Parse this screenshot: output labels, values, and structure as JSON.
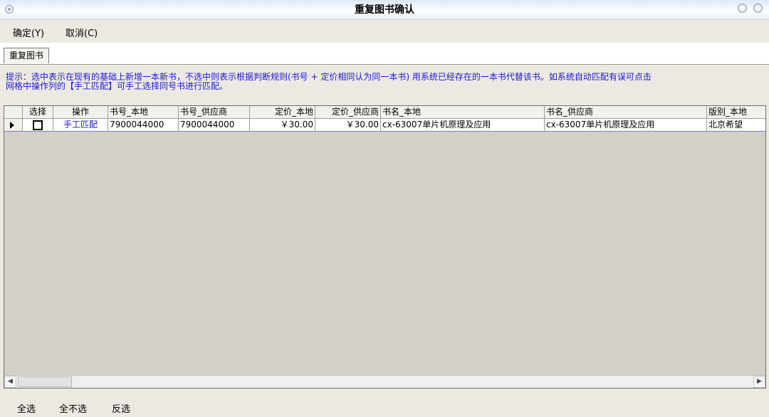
{
  "window": {
    "title": "重复图书确认"
  },
  "menu": {
    "ok_label": "确定(Y)",
    "cancel_label": "取消(C)"
  },
  "tabs": [
    {
      "label": "重复图书"
    }
  ],
  "hint": {
    "line1": "提示：选中表示在现有的基础上新增一本新书，不选中则表示根据判断规则(书号 + 定价相同认为同一本书)  用系统已经存在的一本书代替该书。如系统自动匹配有误可点击",
    "line2": "网格中操作列的【手工匹配】可手工选择同号书进行匹配。"
  },
  "table": {
    "columns": [
      "选择",
      "操作",
      "书号_本地",
      "书号_供应商",
      "定价_本地",
      "定价_供应商",
      "书名_本地",
      "书名_供应商",
      "版别_本地"
    ],
    "rows": [
      {
        "selected": false,
        "action": "手工匹配",
        "isbn_local": "7900044000",
        "isbn_supplier": "7900044000",
        "price_local": "￥30.00",
        "price_supplier": "￥30.00",
        "title_local": "cx-63007单片机原理及应用",
        "title_supplier": "cx-63007单片机原理及应用",
        "publisher_local": "北京希望"
      }
    ]
  },
  "bottom": {
    "select_all": "全选",
    "select_none": "全不选",
    "invert": "反选"
  },
  "colors": {
    "hint_text": "#1b16d4",
    "link_text": "#1b16d4",
    "panel_bg": "#ece9e2",
    "grid_bg": "#d4d0c8"
  }
}
